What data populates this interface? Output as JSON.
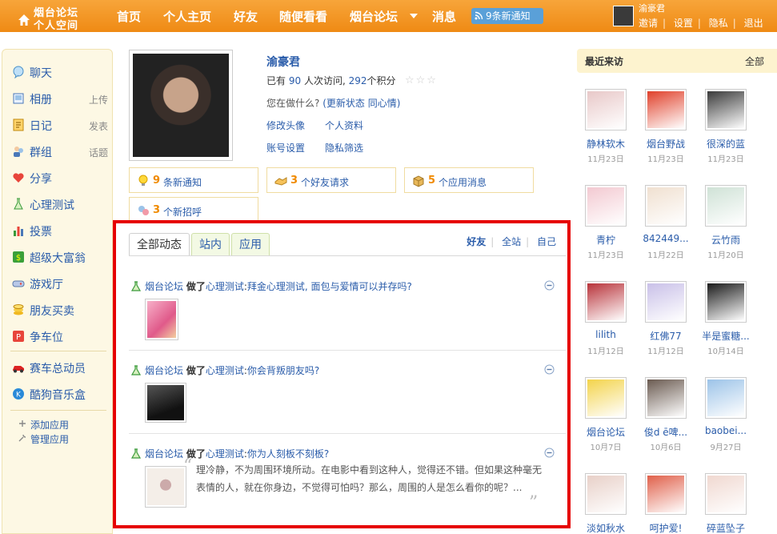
{
  "colors": {
    "topbar": "#f08a14",
    "link": "#2a5caa",
    "highlight": "#e60000",
    "count": "#f08a00"
  },
  "logo": {
    "line1": "烟台论坛",
    "line2": "个人空间"
  },
  "nav": {
    "items": [
      "首页",
      "个人主页",
      "好友",
      "随便看看",
      "烟台论坛",
      "消息"
    ],
    "notice": "9条新通知"
  },
  "user": {
    "name": "渝豪君",
    "links": [
      "邀请",
      "设置",
      "隐私",
      "退出"
    ]
  },
  "sidebar": {
    "items": [
      {
        "label": "聊天",
        "sub": "",
        "icon": "chat-icon"
      },
      {
        "label": "相册",
        "sub": "上传",
        "icon": "album-icon"
      },
      {
        "label": "日记",
        "sub": "发表",
        "icon": "diary-icon"
      },
      {
        "label": "群组",
        "sub": "话题",
        "icon": "group-icon"
      },
      {
        "label": "分享",
        "sub": "",
        "icon": "share-icon"
      },
      {
        "label": "心理测试",
        "sub": "",
        "icon": "flask-icon"
      },
      {
        "label": "投票",
        "sub": "",
        "icon": "poll-icon"
      },
      {
        "label": "超级大富翁",
        "sub": "",
        "icon": "monopoly-icon"
      },
      {
        "label": "游戏厅",
        "sub": "",
        "icon": "game-icon"
      },
      {
        "label": "朋友买卖",
        "sub": "",
        "icon": "coins-icon"
      },
      {
        "label": "争车位",
        "sub": "",
        "icon": "parking-icon"
      },
      {
        "label": "赛车总动员",
        "sub": "",
        "icon": "racecar-icon"
      },
      {
        "label": "酷狗音乐盒",
        "sub": "",
        "icon": "kugou-icon"
      }
    ],
    "add_app": "添加应用",
    "manage_app": "管理应用"
  },
  "profile": {
    "name": "渝豪君",
    "stats_prefix": "已有",
    "visits": "90",
    "visits_text": "人次访问,",
    "points": "292",
    "points_text": "个积分",
    "status_question": "您在做什么?",
    "update_status": "(更新状态",
    "mood": "同心情)",
    "edit_avatar": "修改头像",
    "profile_info": "个人资料",
    "account_settings": "账号设置",
    "privacy_filter": "隐私筛选"
  },
  "notices": [
    {
      "count": "9",
      "text": "条新通知",
      "icon": "bulb-icon"
    },
    {
      "count": "3",
      "text": "个好友请求",
      "icon": "handshake-icon"
    },
    {
      "count": "5",
      "text": "个应用消息",
      "icon": "box-icon"
    },
    {
      "count": "3",
      "text": "个新招呼",
      "icon": "greet-icon"
    }
  ],
  "feed": {
    "tabs": [
      "全部动态",
      "站内",
      "应用"
    ],
    "filters": [
      "好友",
      "全站",
      "自己"
    ],
    "items": [
      {
        "user": "烟台论坛",
        "action": "做了",
        "app": "心理测试",
        "colon": ":",
        "title": "拜金心理测试, 面包与爱情可以并存吗?"
      },
      {
        "user": "烟台论坛",
        "action": "做了",
        "app": "心理测试",
        "colon": ":",
        "title": "你会背叛朋友吗?"
      },
      {
        "user": "烟台论坛",
        "action": "做了",
        "app": "心理测试",
        "colon": ":",
        "title": "你为人刻板不刻板?",
        "quote": "理冷静，不为周围环境所动。在电影中看到这种人，觉得还不错。但如果这种毫无表情的人，就在你身边，不觉得可怕吗？那么，周围的人是怎么看你的呢？..."
      }
    ]
  },
  "recent": {
    "title": "最近来访",
    "all": "全部",
    "visitors": [
      {
        "name": "静林软木",
        "date": "11月23日",
        "color": "#e8c8c8"
      },
      {
        "name": "烟台野战",
        "date": "11月23日",
        "color": "#e0402a"
      },
      {
        "name": "很深的蓝",
        "date": "11月23日",
        "color": "#3a3a3a"
      },
      {
        "name": "青柠",
        "date": "11月23日",
        "color": "#f3c9d1"
      },
      {
        "name": "842449...",
        "date": "11月22日",
        "color": "#f0e0d0"
      },
      {
        "name": "云竹雨",
        "date": "11月20日",
        "color": "#cfe2d6"
      },
      {
        "name": "lilith",
        "date": "11月12日",
        "color": "#b8333a"
      },
      {
        "name": "红佛77",
        "date": "11月12日",
        "color": "#c9c0e8"
      },
      {
        "name": "半是蜜糖...",
        "date": "10月14日",
        "color": "#1a1a1a"
      },
      {
        "name": "烟台论坛",
        "date": "10月7日",
        "color": "#f3d34a"
      },
      {
        "name": "俊d ē啤...",
        "date": "10月6日",
        "color": "#6a5a50"
      },
      {
        "name": "baobei...",
        "date": "9月27日",
        "color": "#9cc3e8"
      },
      {
        "name": "淡如秋水",
        "date": "",
        "color": "#e8d0c8"
      },
      {
        "name": "呵护爱!",
        "date": "",
        "color": "#e0604a"
      },
      {
        "name": "碎蓝坠子",
        "date": "",
        "color": "#f0d8d0"
      }
    ]
  }
}
